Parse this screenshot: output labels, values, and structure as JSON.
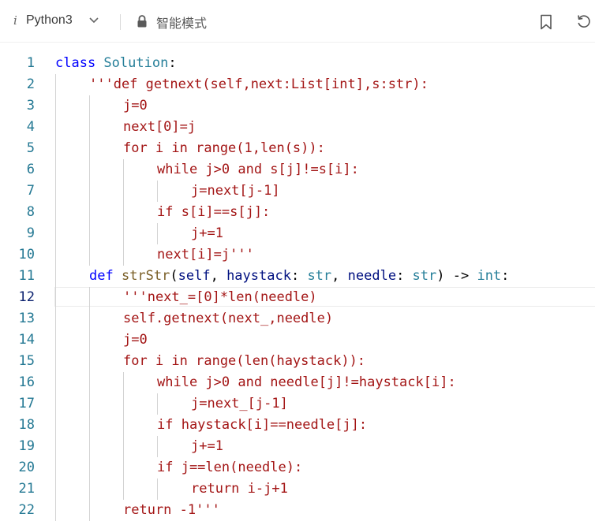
{
  "toolbar": {
    "info_glyph": "i",
    "language": "Python3",
    "mode_label": "智能模式",
    "icons": [
      "chevron-down-icon",
      "lock-icon",
      "bookmark-icon",
      "reset-icon"
    ]
  },
  "editor": {
    "current_line": 12,
    "lines": [
      {
        "n": "1",
        "indent": 0,
        "tokens": [
          {
            "t": "class ",
            "c": "kw"
          },
          {
            "t": "Solution",
            "c": "cls"
          },
          {
            "t": ":",
            "c": "plain"
          }
        ]
      },
      {
        "n": "2",
        "indent": 1,
        "tokens": [
          {
            "t": "'''def getnext(self,next:List[int],s:str):",
            "c": "str"
          }
        ]
      },
      {
        "n": "3",
        "indent": 2,
        "tokens": [
          {
            "t": "j=0",
            "c": "str"
          }
        ]
      },
      {
        "n": "4",
        "indent": 2,
        "tokens": [
          {
            "t": "next[0]=j",
            "c": "str"
          }
        ]
      },
      {
        "n": "5",
        "indent": 2,
        "tokens": [
          {
            "t": "for i in range(1,len(s)):",
            "c": "str"
          }
        ]
      },
      {
        "n": "6",
        "indent": 3,
        "tokens": [
          {
            "t": "while j>0 and s[j]!=s[i]:",
            "c": "str"
          }
        ]
      },
      {
        "n": "7",
        "indent": 4,
        "tokens": [
          {
            "t": "j=next[j-1]",
            "c": "str"
          }
        ]
      },
      {
        "n": "8",
        "indent": 3,
        "tokens": [
          {
            "t": "if s[i]==s[j]:",
            "c": "str"
          }
        ]
      },
      {
        "n": "9",
        "indent": 4,
        "tokens": [
          {
            "t": "j+=1",
            "c": "str"
          }
        ]
      },
      {
        "n": "10",
        "indent": 3,
        "tokens": [
          {
            "t": "next[i]=j'''",
            "c": "str"
          }
        ]
      },
      {
        "n": "11",
        "indent": 1,
        "tokens": [
          {
            "t": "def ",
            "c": "kw"
          },
          {
            "t": "strStr",
            "c": "fn"
          },
          {
            "t": "(",
            "c": "plain"
          },
          {
            "t": "self",
            "c": "param"
          },
          {
            "t": ", ",
            "c": "plain"
          },
          {
            "t": "haystack",
            "c": "param"
          },
          {
            "t": ": ",
            "c": "plain"
          },
          {
            "t": "str",
            "c": "cls"
          },
          {
            "t": ", ",
            "c": "plain"
          },
          {
            "t": "needle",
            "c": "param"
          },
          {
            "t": ": ",
            "c": "plain"
          },
          {
            "t": "str",
            "c": "cls"
          },
          {
            "t": ") -> ",
            "c": "plain"
          },
          {
            "t": "int",
            "c": "cls"
          },
          {
            "t": ":",
            "c": "plain"
          }
        ]
      },
      {
        "n": "12",
        "indent": 2,
        "tokens": [
          {
            "t": "'''next_=[0]*len(needle)",
            "c": "str"
          }
        ]
      },
      {
        "n": "13",
        "indent": 2,
        "tokens": [
          {
            "t": "self.getnext(next_,needle)",
            "c": "str"
          }
        ]
      },
      {
        "n": "14",
        "indent": 2,
        "tokens": [
          {
            "t": "j=0",
            "c": "str"
          }
        ]
      },
      {
        "n": "15",
        "indent": 2,
        "tokens": [
          {
            "t": "for i in range(len(haystack)):",
            "c": "str"
          }
        ]
      },
      {
        "n": "16",
        "indent": 3,
        "tokens": [
          {
            "t": "while j>0 and needle[j]!=haystack[i]:",
            "c": "str"
          }
        ]
      },
      {
        "n": "17",
        "indent": 4,
        "tokens": [
          {
            "t": "j=next_[j-1]",
            "c": "str"
          }
        ]
      },
      {
        "n": "18",
        "indent": 3,
        "tokens": [
          {
            "t": "if haystack[i]==needle[j]:",
            "c": "str"
          }
        ]
      },
      {
        "n": "19",
        "indent": 4,
        "tokens": [
          {
            "t": "j+=1",
            "c": "str"
          }
        ]
      },
      {
        "n": "20",
        "indent": 3,
        "tokens": [
          {
            "t": "if j==len(needle):",
            "c": "str"
          }
        ]
      },
      {
        "n": "21",
        "indent": 4,
        "tokens": [
          {
            "t": "return i-j+1",
            "c": "str"
          }
        ]
      },
      {
        "n": "22",
        "indent": 2,
        "tokens": [
          {
            "t": "return -1'''",
            "c": "str"
          }
        ]
      }
    ]
  }
}
